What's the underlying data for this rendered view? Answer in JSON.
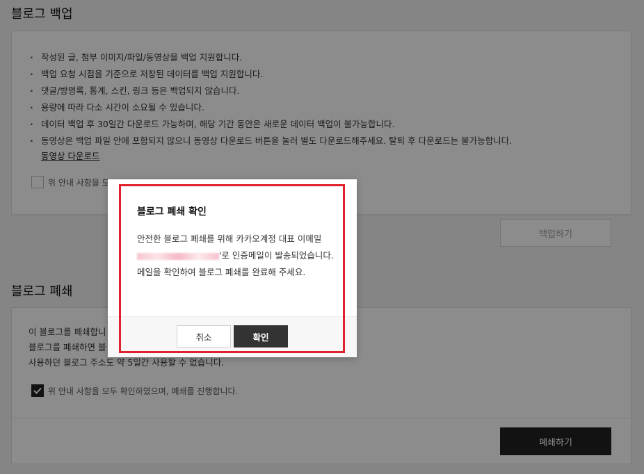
{
  "backup": {
    "title": "블로그 백업",
    "items": [
      "작성된 글, 첨부 이미지/파일/동영상을 백업 지원합니다.",
      "백업 요청 시점을 기준으로 저장된 데이터를 백업 지원합니다.",
      "댓글/방명록, 통계, 스킨, 링크 등은 백업되지 않습니다.",
      "용량에 따라 다소 시간이 소요될 수 있습니다.",
      "데이터 백업 후 30일간 다운로드 가능하며, 해당 기간 동안은 새로운 데이터 백업이 불가능합니다.",
      "동영상은 백업 파일 안에 포함되지 않으니 동영상 다운로드 버튼을 눌러 별도 다운로드해주세요. 탈퇴 후 다운로드는 불가능합니다."
    ],
    "video_link": "동영상 다운로드",
    "agree_label": "위 안내 사항을 모",
    "button": "백업하기"
  },
  "close": {
    "title": "블로그 폐쇄",
    "lines": [
      "이 블로그를 폐쇄합니",
      "블로그를 폐쇄하면 블",
      "사용하던 블로그 주소도 약 5일간 사용할 수 없습니다."
    ],
    "agree_label": "위 안내 사항을 모두 확인하였으며, 폐쇄를 진행합니다.",
    "button": "폐쇄하기"
  },
  "modal": {
    "title": "블로그 폐쇄 확인",
    "body_prefix": "안전한 블로그 폐쇄를 위해 카카오계정 대표 이메일",
    "body_suffix": "'로 인증메일이 발송되었습니다. 메일을 확인하여 블로그 폐쇄를 완료해 주세요.",
    "cancel": "취소",
    "confirm": "확인"
  },
  "colors": {
    "highlight": "#e0212b",
    "dark_button": "#222222"
  }
}
